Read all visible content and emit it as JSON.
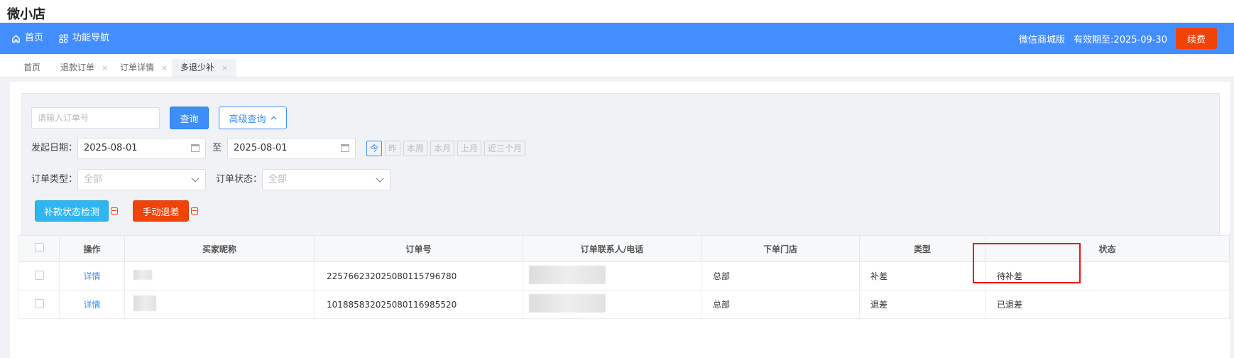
{
  "app": {
    "title": "微小店"
  },
  "nav": {
    "home": "首页",
    "function_nav": "功能导航",
    "edition": "微信商城版",
    "expiry": "有效期至:2025-09-30",
    "renew": "续费"
  },
  "tabs": [
    {
      "label": "首页",
      "closable": false
    },
    {
      "label": "退款订单",
      "closable": true
    },
    {
      "label": "订单详情",
      "closable": true
    },
    {
      "label": "多退少补",
      "closable": true,
      "active": true
    }
  ],
  "tab_close": "×",
  "filter": {
    "order_no_placeholder": "请输入订单号",
    "query": "查询",
    "advanced_query": "高级查询",
    "date_label": "发起日期：",
    "date_from": "2025-08-01",
    "date_to_label": "至",
    "date_to": "2025-08-01",
    "quick_dates": [
      "今",
      "昨",
      "本周",
      "本月",
      "上月",
      "近三个月"
    ],
    "order_type_label": "订单类型：",
    "order_type_value": "全部",
    "order_status_label": "订单状态：",
    "order_status_value": "全部",
    "check_btn": "补款状态检测",
    "manual_btn": "手动退差"
  },
  "table": {
    "headers": [
      "操作",
      "买家昵称",
      "订单号",
      "订单联系人/电话",
      "下单门店",
      "类型",
      "状态"
    ],
    "rows": [
      {
        "action": "详情",
        "order_no": "225766232025080115796780",
        "store": "总部",
        "type": "补差",
        "status": "待补差"
      },
      {
        "action": "详情",
        "order_no": "101885832025080116985520",
        "store": "总部",
        "type": "退差",
        "status": "已退差"
      }
    ]
  },
  "colors": {
    "nav_bg": "#438eff",
    "primary": "#3d8ef8",
    "danger": "#f0430a",
    "cyan": "#2fb6f0"
  }
}
